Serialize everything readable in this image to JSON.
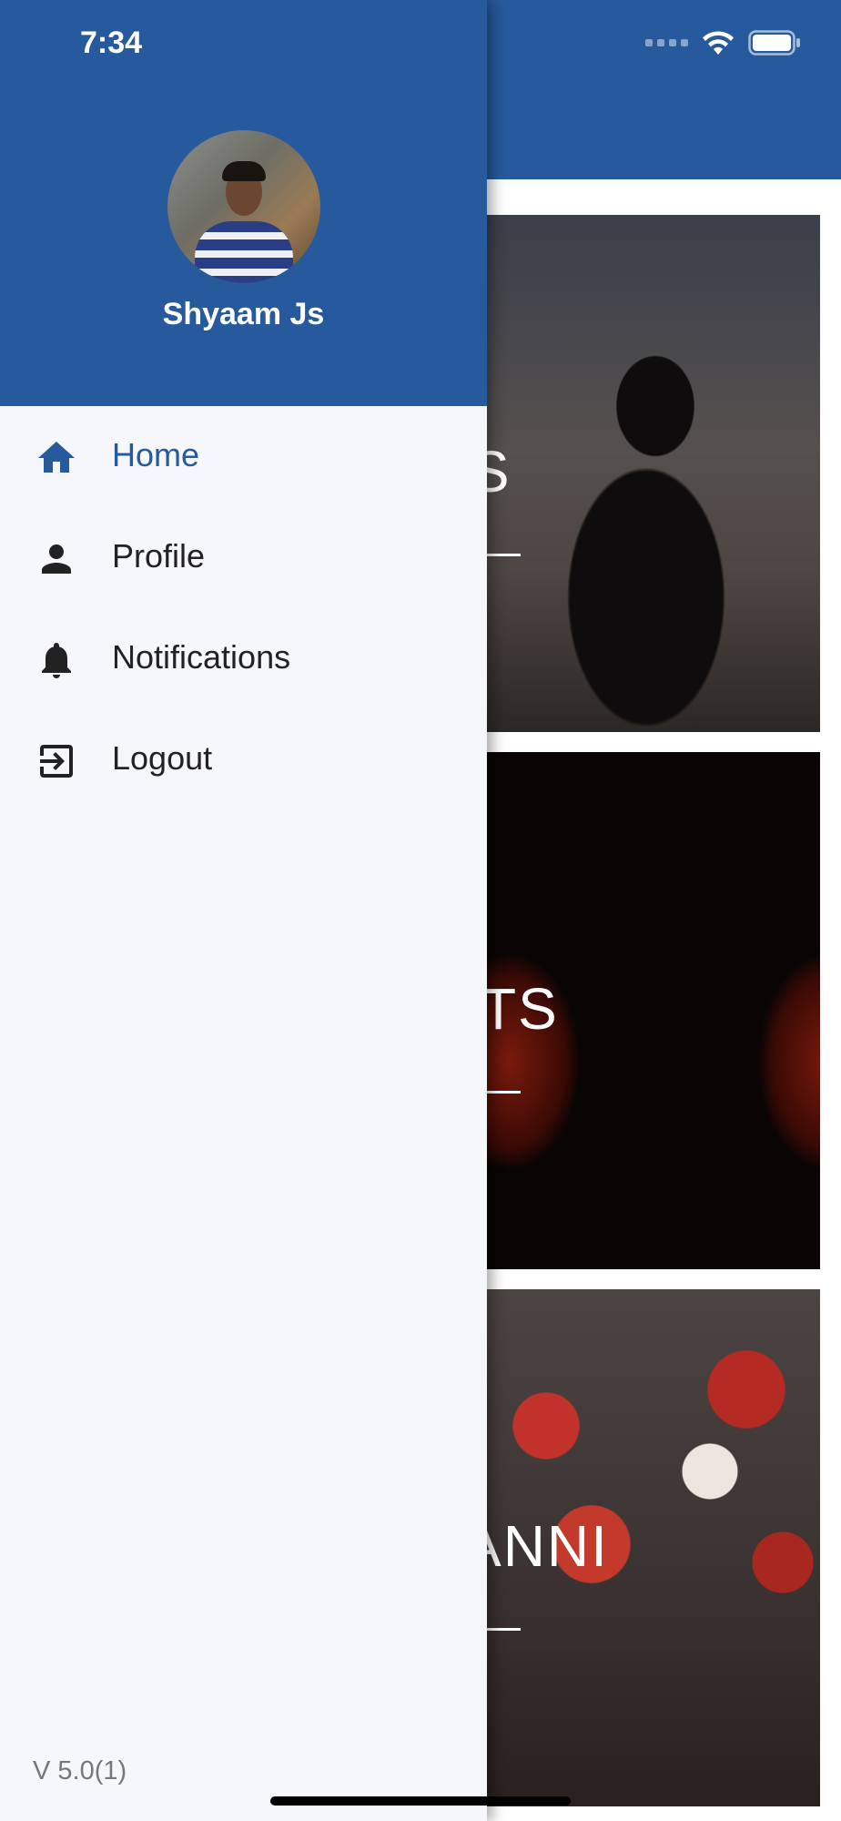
{
  "status_bar": {
    "time": "7:34"
  },
  "background": {
    "cards": [
      {
        "title_partial": "ERS"
      },
      {
        "title_partial": "TS"
      },
      {
        "title_partial": "ANNI"
      }
    ]
  },
  "drawer": {
    "user_name": "Shyaam Js",
    "menu": [
      {
        "label": "Home",
        "icon": "home-icon",
        "active": true
      },
      {
        "label": "Profile",
        "icon": "person-icon",
        "active": false
      },
      {
        "label": "Notifications",
        "icon": "bell-icon",
        "active": false
      },
      {
        "label": "Logout",
        "icon": "logout-icon",
        "active": false
      }
    ],
    "version": "V 5.0(1)"
  },
  "colors": {
    "primary": "#275a9c",
    "drawer_bg": "#f6f7fb",
    "text": "#222222"
  }
}
